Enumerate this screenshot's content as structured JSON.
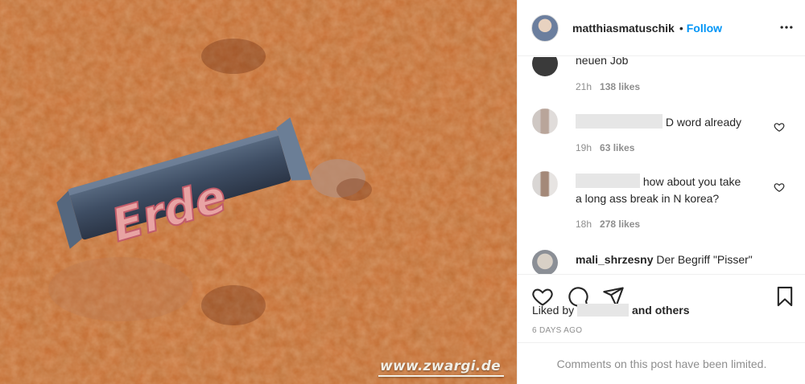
{
  "photo": {
    "bar_label": "Erde",
    "watermark": "www.zwargi.de"
  },
  "post": {
    "username": "matthiasmatuschik",
    "separator": "•",
    "follow_label": "Follow"
  },
  "comments": [
    {
      "text": "neuen Job",
      "time": "21h",
      "likes": "138 likes"
    },
    {
      "text": "D word already",
      "time": "19h",
      "likes": "63 likes"
    },
    {
      "text_line1": "how about you take",
      "text_line2": "a long ass break in N korea?",
      "time": "18h",
      "likes": "278 likes"
    },
    {
      "username": "mali_shrzesny",
      "text": "Der Begriff \"Pisser\""
    }
  ],
  "likes_summary": {
    "prefix": "Liked by",
    "suffix": "and others"
  },
  "post_age": "6 DAYS AGO",
  "comments_limited": "Comments on this post have been limited.",
  "icons": [
    "more-icon",
    "heart-icon",
    "comment-icon",
    "share-icon",
    "bookmark-icon"
  ],
  "colors": {
    "accent": "#0095f6",
    "muted": "#8e8e8e",
    "text": "#262626"
  }
}
